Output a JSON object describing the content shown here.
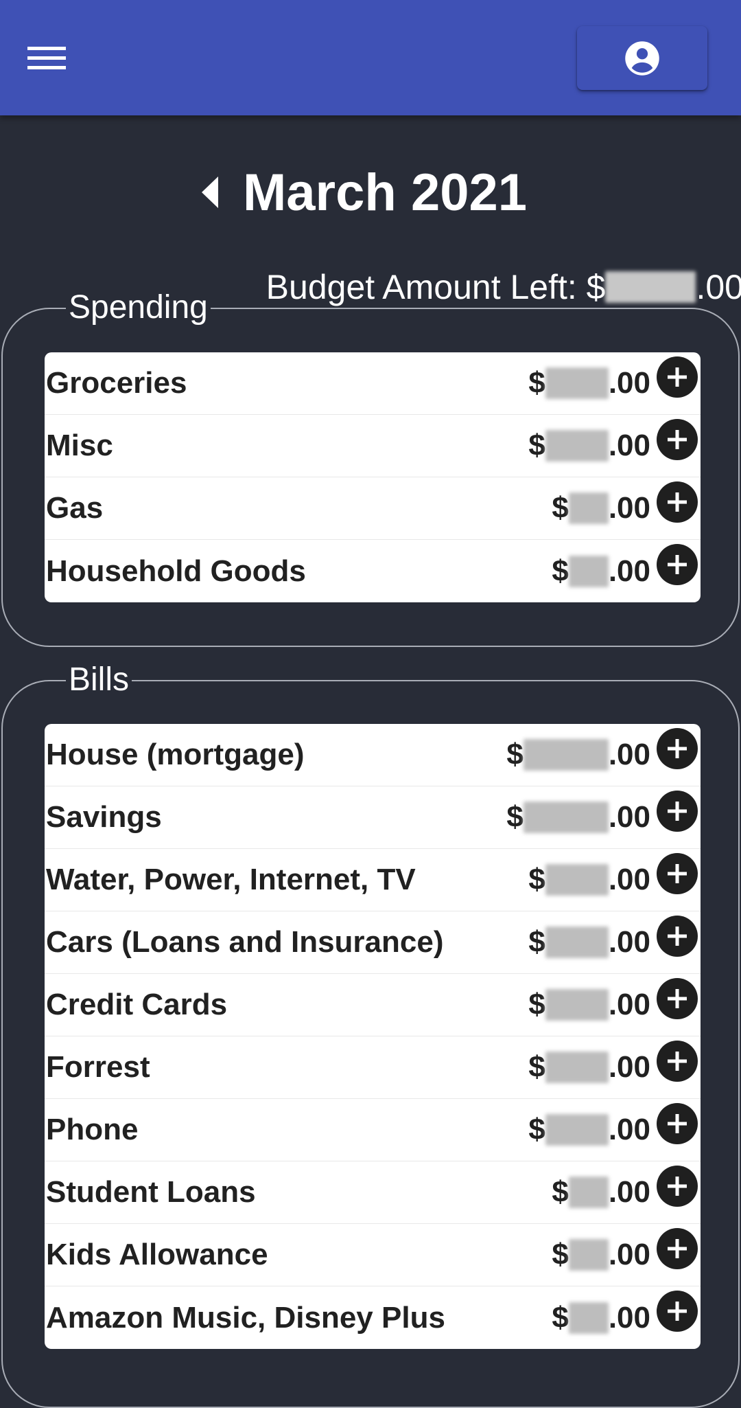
{
  "app": {
    "menu_icon": "hamburger-menu-icon",
    "account_icon": "account-circle-icon",
    "accent_color": "#3f51b5",
    "background_color": "#282c37"
  },
  "header": {
    "prev_icon": "chevron-left-icon",
    "month_title": "March 2021",
    "budget_label": "Budget Amount Left: $",
    "budget_suffix": ".00"
  },
  "spending": {
    "legend": "Spending",
    "items": [
      {
        "name": "Groceries",
        "currency": "$",
        "cents": ".00"
      },
      {
        "name": "Misc",
        "currency": "$",
        "cents": ".00"
      },
      {
        "name": "Gas",
        "currency": "$",
        "cents": ".00"
      },
      {
        "name": "Household Goods",
        "currency": "$",
        "cents": ".00"
      }
    ]
  },
  "bills": {
    "legend": "Bills",
    "items": [
      {
        "name": "House (mortgage)",
        "currency": "$",
        "cents": ".00"
      },
      {
        "name": "Savings",
        "currency": "$",
        "cents": ".00"
      },
      {
        "name": "Water, Power, Internet, TV",
        "currency": "$",
        "cents": ".00"
      },
      {
        "name": "Cars (Loans and Insurance)",
        "currency": "$",
        "cents": ".00"
      },
      {
        "name": "Credit Cards",
        "currency": "$",
        "cents": ".00"
      },
      {
        "name": "Forrest",
        "currency": "$",
        "cents": ".00"
      },
      {
        "name": "Phone",
        "currency": "$",
        "cents": ".00"
      },
      {
        "name": "Student Loans",
        "currency": "$",
        "cents": ".00"
      },
      {
        "name": "Kids Allowance",
        "currency": "$",
        "cents": ".00"
      },
      {
        "name": "Amazon Music, Disney Plus",
        "currency": "$",
        "cents": ".00"
      }
    ]
  },
  "add_icon": "plus-circle-icon"
}
